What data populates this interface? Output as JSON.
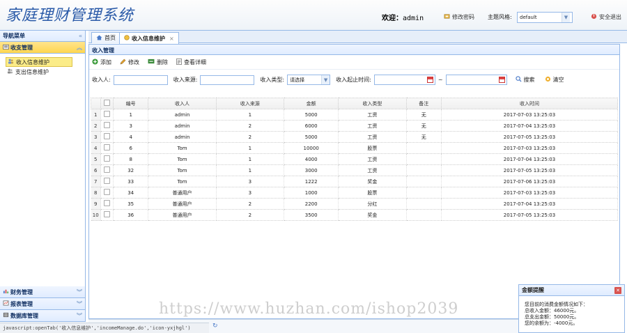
{
  "app": {
    "title": "家庭理财管理系统"
  },
  "header": {
    "welcome_label": "欢迎：",
    "username": "admin",
    "change_password": "修改密码",
    "theme_label": "主题风格:",
    "theme_value": "default",
    "logout": "安全退出"
  },
  "sidebar": {
    "title": "导航菜单",
    "sections": [
      {
        "label": "收支管理",
        "items": [
          "收入信息维护",
          "支出信息维护"
        ]
      },
      {
        "label": "财务管理"
      },
      {
        "label": "报表管理"
      },
      {
        "label": "数据库管理"
      }
    ]
  },
  "tabs": [
    {
      "label": "首页"
    },
    {
      "label": "收入信息维护",
      "close": "×"
    }
  ],
  "main": {
    "title": "收入管理",
    "toolbar": {
      "add": "添加",
      "edit": "修改",
      "delete": "删除",
      "detail": "查看详细"
    },
    "search": {
      "income_person": "收入人:",
      "income_source": "收入来源:",
      "income_type": "收入类型:",
      "income_type_value": "请选择",
      "date_range": "收入起止时间:",
      "tilde": "~",
      "search_btn": "搜索",
      "clear_btn": "清空"
    }
  },
  "grid": {
    "columns": [
      "编号",
      "收入人",
      "收入来源",
      "金额",
      "收入类型",
      "备注",
      "收入时间"
    ],
    "rows": [
      [
        "1",
        "1",
        "admin",
        "1",
        "5000",
        "工资",
        "无",
        "2017-07-03 13:25:03"
      ],
      [
        "2",
        "3",
        "admin",
        "2",
        "6000",
        "工资",
        "无",
        "2017-07-04 13:25:03"
      ],
      [
        "3",
        "4",
        "admin",
        "2",
        "5000",
        "工资",
        "无",
        "2017-07-05 13:25:03"
      ],
      [
        "4",
        "6",
        "Tom",
        "1",
        "10000",
        "股票",
        "",
        "2017-07-03 13:25:03"
      ],
      [
        "5",
        "8",
        "Tom",
        "1",
        "4000",
        "工资",
        "",
        "2017-07-04 13:25:03"
      ],
      [
        "6",
        "32",
        "Tom",
        "1",
        "3000",
        "工资",
        "",
        "2017-07-05 13:25:03"
      ],
      [
        "7",
        "33",
        "Tom",
        "3",
        "1222",
        "奖金",
        "",
        "2017-07-06 13:25:03"
      ],
      [
        "8",
        "34",
        "普通用户",
        "3",
        "1000",
        "股票",
        "",
        "2017-07-03 13:25:03"
      ],
      [
        "9",
        "35",
        "普通用户",
        "2",
        "2200",
        "分红",
        "",
        "2017-07-04 13:25:03"
      ],
      [
        "10",
        "36",
        "普通用户",
        "2",
        "3500",
        "奖金",
        "",
        "2017-07-05 13:25:03"
      ]
    ]
  },
  "statusbar": {
    "text": "javascript:openTab('收入信息维护','incomeManage.do','icon-yxjhgl')"
  },
  "notify": {
    "title": "金额提醒",
    "lines": [
      "您目前的消费金额情况如下：",
      "总收入金额：46000元。",
      "总支出金额：50000元。",
      "您的余额为：-4000元。"
    ]
  },
  "watermark": "https://www.huzhan.com/ishop2039",
  "colors": {
    "border": "#95b8e7",
    "accent": "#ffd64f",
    "title": "#2a5aa8"
  }
}
